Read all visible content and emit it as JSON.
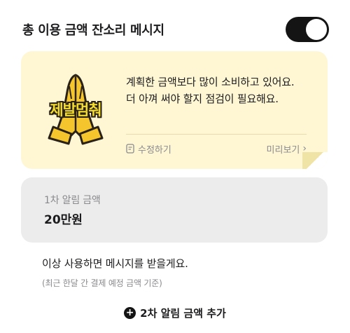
{
  "header": {
    "title": "총 이용 금액 잔소리 메시지",
    "toggle_on": true
  },
  "message_card": {
    "sticker_icon": "praying-hands-sticker",
    "sticker_text": "제발멈춰",
    "line1": "계획한 금액보다 많이 소비하고 있어요.",
    "line2": "더 아껴 써야 할지 점검이 필요해요.",
    "edit_label": "수정하기",
    "preview_label": "미리보기",
    "preview_chevron": "›"
  },
  "amount_card": {
    "label": "1차 알림 금액",
    "value": "20만원"
  },
  "notes": {
    "main": "이상 사용하면 메시지를 받을게요.",
    "sub": "(최근 한달 간 결제 예정 금액 기준)"
  },
  "add_button": {
    "label": "2차 알림 금액 추가",
    "icon": "plus-circle-icon"
  },
  "colors": {
    "card_bg": "#fff6d3",
    "amount_bg": "#ececec",
    "toggle_on": "#141414",
    "sticker_yellow": "#f4dc2c"
  }
}
